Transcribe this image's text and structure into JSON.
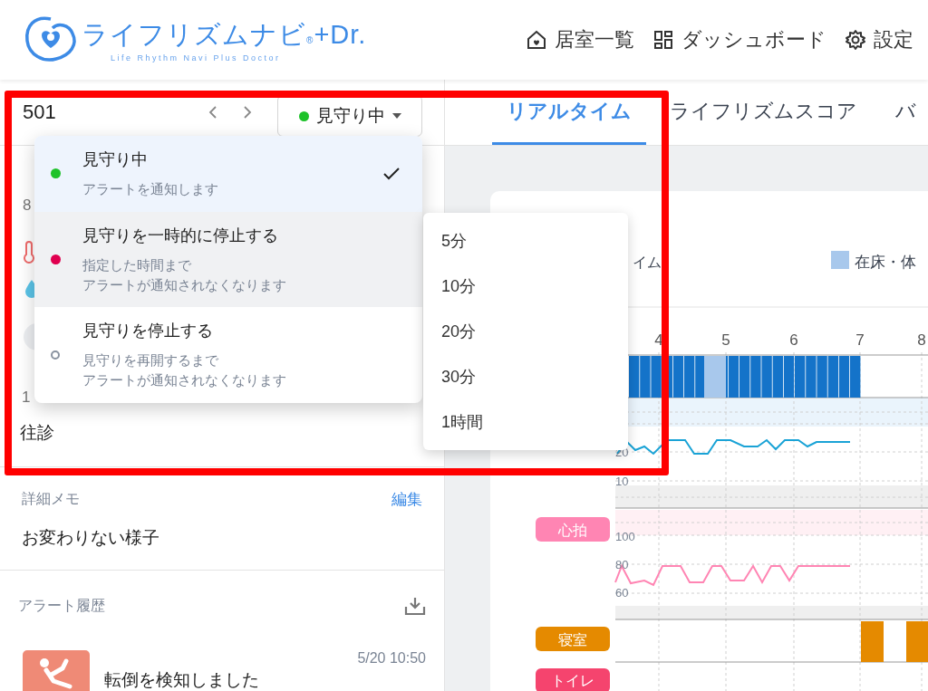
{
  "header": {
    "logo": {
      "title": "ライフリズムナビ",
      "registered": "®",
      "suffix": "+Dr.",
      "subtitle": "Life Rhythm Navi  Plus Doctor"
    },
    "nav": [
      {
        "label": "居室一覧",
        "kind": "home"
      },
      {
        "label": "ダッシュボード",
        "kind": "dashboard"
      },
      {
        "label": "設定",
        "kind": "settings"
      }
    ]
  },
  "room": {
    "number": "501",
    "status": {
      "label": "見守り中",
      "color": "#1ec22a"
    }
  },
  "status_menu": {
    "options": [
      {
        "title": "見守り中",
        "description": [
          "アラートを通知します"
        ],
        "color": "#1ec22a",
        "kind": "dot",
        "selected": true,
        "expanded": false
      },
      {
        "title": "見守りを一時的に停止する",
        "description": [
          "指定した時間まで",
          "アラートが通知されなくなります"
        ],
        "color": "#e0004f",
        "kind": "dot",
        "selected": false,
        "expanded": true
      },
      {
        "title": "見守りを停止する",
        "description": [
          "見守りを再開するまで",
          "アラートが通知されなくなります"
        ],
        "color": "#8a93a0",
        "kind": "ring",
        "selected": false,
        "expanded": false
      }
    ]
  },
  "pause_durations": [
    "5分",
    "10分",
    "20分",
    "30分",
    "1時間"
  ],
  "resident": {
    "partial_text_1": "8",
    "partial_text_2": "1",
    "visit": "往診"
  },
  "memo": {
    "label": "詳細メモ",
    "edit": "編集",
    "text": "お変わりない様子"
  },
  "alert_history": {
    "label": "アラート履歴",
    "items": [
      {
        "time": "5/20 10:50",
        "message": "転倒を検知しました"
      }
    ]
  },
  "tabs": [
    {
      "label": "リアルタイム",
      "selected": true
    },
    {
      "label": "ライフリズムスコア",
      "selected": false
    },
    {
      "label": "バ",
      "selected": false
    }
  ],
  "realtime_card": {
    "title_partial": "イム",
    "legend": [
      {
        "label": "在床・体",
        "color": "#a8c8ec"
      }
    ],
    "hour_ticks": [
      "4",
      "5",
      "6",
      "7",
      "8"
    ],
    "respiration_ticks": [
      "20",
      "10"
    ],
    "heart_ticks": [
      "100",
      "80",
      "60"
    ],
    "rows": [
      {
        "label": "心拍",
        "color": "#ff85b3"
      },
      {
        "label": "寝室",
        "color": "#e58a00"
      },
      {
        "label": "トイレ",
        "color": "#f5446e"
      }
    ]
  }
}
